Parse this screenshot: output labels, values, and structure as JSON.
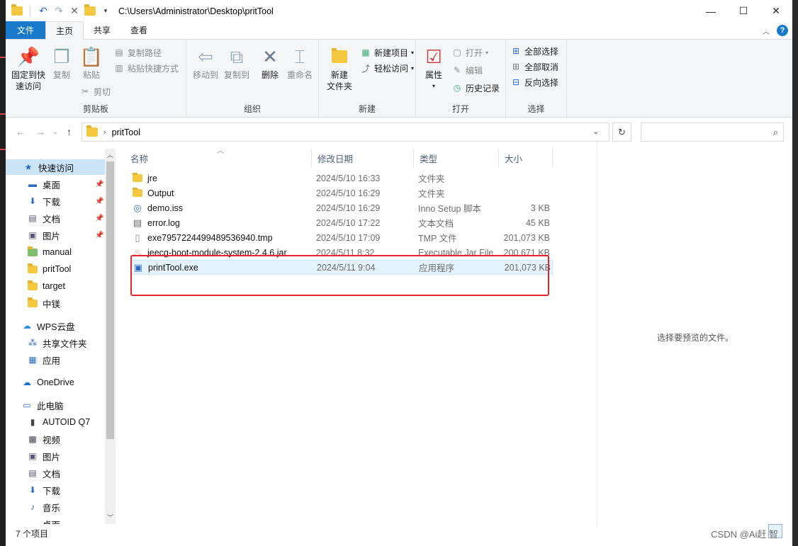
{
  "window": {
    "title_path": "C:\\Users\\Administrator\\Desktop\\pritTool",
    "controls": {
      "minimize": "—",
      "maximize": "☐",
      "close": "✕"
    }
  },
  "ribbon_tabs": [
    {
      "label": "文件"
    },
    {
      "label": "主页"
    },
    {
      "label": "共享"
    },
    {
      "label": "查看"
    }
  ],
  "ribbon": {
    "clipboard": {
      "label": "剪贴板",
      "pin": "固定到快速访问",
      "pin_l1": "固定到快",
      "pin_l2": "速访问",
      "copy": "复制",
      "paste": "粘贴",
      "copy_path": "复制路径",
      "paste_shortcut": "粘贴快捷方式",
      "cut": "剪切"
    },
    "organize": {
      "label": "组织",
      "move_to": "移动到",
      "copy_to": "复制到",
      "delete": "删除",
      "rename": "重命名"
    },
    "new": {
      "label": "新建",
      "new_folder_l1": "新建",
      "new_folder_l2": "文件夹",
      "new_item": "新建项目",
      "easy_access": "轻松访问"
    },
    "open": {
      "label": "打开",
      "properties": "属性",
      "open": "打开",
      "edit": "编辑",
      "history": "历史记录"
    },
    "select": {
      "label": "选择",
      "select_all": "全部选择",
      "select_none": "全部取消",
      "invert": "反向选择"
    }
  },
  "address": {
    "crumb": "pritTool",
    "search_placeholder": ""
  },
  "nav_pane": {
    "items": [
      {
        "label": "快速访问",
        "icon": "star-icon"
      },
      {
        "label": "桌面",
        "icon": "desktop-icon",
        "pinned": true
      },
      {
        "label": "下载",
        "icon": "download-icon",
        "pinned": true
      },
      {
        "label": "文档",
        "icon": "document-icon",
        "pinned": true
      },
      {
        "label": "图片",
        "icon": "picture-icon",
        "pinned": true
      },
      {
        "label": "manual",
        "icon": "folder-icon"
      },
      {
        "label": "pritTool",
        "icon": "folder-icon"
      },
      {
        "label": "target",
        "icon": "folder-icon"
      },
      {
        "label": "中镁",
        "icon": "folder-icon"
      },
      {
        "label": "WPS云盘",
        "icon": "cloud-icon"
      },
      {
        "label": "共享文件夹",
        "icon": "share-icon"
      },
      {
        "label": "应用",
        "icon": "apps-icon"
      },
      {
        "label": "OneDrive",
        "icon": "onedrive-icon"
      },
      {
        "label": "此电脑",
        "icon": "computer-icon"
      },
      {
        "label": "AUTOID Q7",
        "icon": "device-icon"
      },
      {
        "label": "视频",
        "icon": "video-icon"
      },
      {
        "label": "图片",
        "icon": "picture-icon"
      },
      {
        "label": "文档",
        "icon": "document-icon"
      },
      {
        "label": "下载",
        "icon": "download-icon"
      },
      {
        "label": "音乐",
        "icon": "music-icon"
      },
      {
        "label": "桌面",
        "icon": "desktop-icon"
      }
    ]
  },
  "file_list": {
    "columns": {
      "name": "名称",
      "date": "修改日期",
      "type": "类型",
      "size": "大小"
    },
    "rows": [
      {
        "name": "jre",
        "date": "2024/5/10 16:33",
        "type": "文件夹",
        "size": "",
        "icon": "folder-icon"
      },
      {
        "name": "Output",
        "date": "2024/5/10 16:29",
        "type": "文件夹",
        "size": "",
        "icon": "folder-icon"
      },
      {
        "name": "demo.iss",
        "date": "2024/5/10 16:29",
        "type": "Inno Setup 脚本",
        "size": "3 KB",
        "icon": "inno-setup-icon"
      },
      {
        "name": "error.log",
        "date": "2024/5/10 17:22",
        "type": "文本文档",
        "size": "45 KB",
        "icon": "text-file-icon"
      },
      {
        "name": "exe7957224499489536940.tmp",
        "date": "2024/5/10 17:09",
        "type": "TMP 文件",
        "size": "201,073 KB",
        "icon": "file-icon"
      },
      {
        "name": "jeecg-boot-module-system-2.4.6.jar",
        "date": "2024/5/11 8:32",
        "type": "Executable Jar File",
        "size": "200,671 KB",
        "icon": "jar-icon"
      },
      {
        "name": "printTool.exe",
        "date": "2024/5/11 9:04",
        "type": "应用程序",
        "size": "201,073 KB",
        "icon": "exe-icon",
        "selected": true
      }
    ]
  },
  "preview": {
    "text": "选择要预览的文件。"
  },
  "status": {
    "count": "7 个项目"
  },
  "watermark": "CSDN @Ai赶 智"
}
